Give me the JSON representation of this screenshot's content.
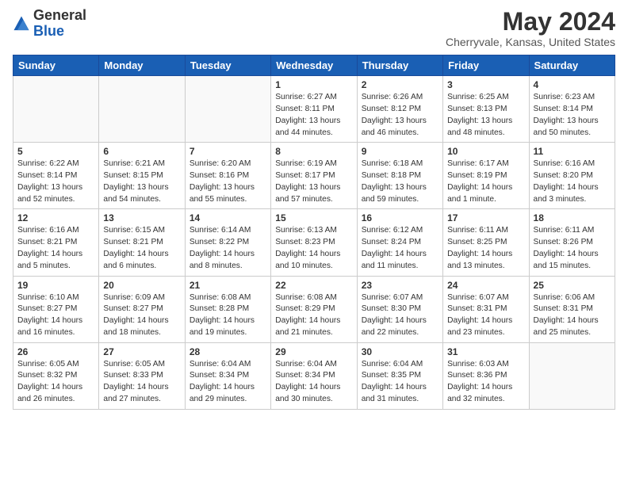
{
  "header": {
    "logo_general": "General",
    "logo_blue": "Blue",
    "month_year": "May 2024",
    "location": "Cherryvale, Kansas, United States"
  },
  "days_of_week": [
    "Sunday",
    "Monday",
    "Tuesday",
    "Wednesday",
    "Thursday",
    "Friday",
    "Saturday"
  ],
  "weeks": [
    [
      {
        "day": "",
        "info": ""
      },
      {
        "day": "",
        "info": ""
      },
      {
        "day": "",
        "info": ""
      },
      {
        "day": "1",
        "info": "Sunrise: 6:27 AM\nSunset: 8:11 PM\nDaylight: 13 hours\nand 44 minutes."
      },
      {
        "day": "2",
        "info": "Sunrise: 6:26 AM\nSunset: 8:12 PM\nDaylight: 13 hours\nand 46 minutes."
      },
      {
        "day": "3",
        "info": "Sunrise: 6:25 AM\nSunset: 8:13 PM\nDaylight: 13 hours\nand 48 minutes."
      },
      {
        "day": "4",
        "info": "Sunrise: 6:23 AM\nSunset: 8:14 PM\nDaylight: 13 hours\nand 50 minutes."
      }
    ],
    [
      {
        "day": "5",
        "info": "Sunrise: 6:22 AM\nSunset: 8:14 PM\nDaylight: 13 hours\nand 52 minutes."
      },
      {
        "day": "6",
        "info": "Sunrise: 6:21 AM\nSunset: 8:15 PM\nDaylight: 13 hours\nand 54 minutes."
      },
      {
        "day": "7",
        "info": "Sunrise: 6:20 AM\nSunset: 8:16 PM\nDaylight: 13 hours\nand 55 minutes."
      },
      {
        "day": "8",
        "info": "Sunrise: 6:19 AM\nSunset: 8:17 PM\nDaylight: 13 hours\nand 57 minutes."
      },
      {
        "day": "9",
        "info": "Sunrise: 6:18 AM\nSunset: 8:18 PM\nDaylight: 13 hours\nand 59 minutes."
      },
      {
        "day": "10",
        "info": "Sunrise: 6:17 AM\nSunset: 8:19 PM\nDaylight: 14 hours\nand 1 minute."
      },
      {
        "day": "11",
        "info": "Sunrise: 6:16 AM\nSunset: 8:20 PM\nDaylight: 14 hours\nand 3 minutes."
      }
    ],
    [
      {
        "day": "12",
        "info": "Sunrise: 6:16 AM\nSunset: 8:21 PM\nDaylight: 14 hours\nand 5 minutes."
      },
      {
        "day": "13",
        "info": "Sunrise: 6:15 AM\nSunset: 8:21 PM\nDaylight: 14 hours\nand 6 minutes."
      },
      {
        "day": "14",
        "info": "Sunrise: 6:14 AM\nSunset: 8:22 PM\nDaylight: 14 hours\nand 8 minutes."
      },
      {
        "day": "15",
        "info": "Sunrise: 6:13 AM\nSunset: 8:23 PM\nDaylight: 14 hours\nand 10 minutes."
      },
      {
        "day": "16",
        "info": "Sunrise: 6:12 AM\nSunset: 8:24 PM\nDaylight: 14 hours\nand 11 minutes."
      },
      {
        "day": "17",
        "info": "Sunrise: 6:11 AM\nSunset: 8:25 PM\nDaylight: 14 hours\nand 13 minutes."
      },
      {
        "day": "18",
        "info": "Sunrise: 6:11 AM\nSunset: 8:26 PM\nDaylight: 14 hours\nand 15 minutes."
      }
    ],
    [
      {
        "day": "19",
        "info": "Sunrise: 6:10 AM\nSunset: 8:27 PM\nDaylight: 14 hours\nand 16 minutes."
      },
      {
        "day": "20",
        "info": "Sunrise: 6:09 AM\nSunset: 8:27 PM\nDaylight: 14 hours\nand 18 minutes."
      },
      {
        "day": "21",
        "info": "Sunrise: 6:08 AM\nSunset: 8:28 PM\nDaylight: 14 hours\nand 19 minutes."
      },
      {
        "day": "22",
        "info": "Sunrise: 6:08 AM\nSunset: 8:29 PM\nDaylight: 14 hours\nand 21 minutes."
      },
      {
        "day": "23",
        "info": "Sunrise: 6:07 AM\nSunset: 8:30 PM\nDaylight: 14 hours\nand 22 minutes."
      },
      {
        "day": "24",
        "info": "Sunrise: 6:07 AM\nSunset: 8:31 PM\nDaylight: 14 hours\nand 23 minutes."
      },
      {
        "day": "25",
        "info": "Sunrise: 6:06 AM\nSunset: 8:31 PM\nDaylight: 14 hours\nand 25 minutes."
      }
    ],
    [
      {
        "day": "26",
        "info": "Sunrise: 6:05 AM\nSunset: 8:32 PM\nDaylight: 14 hours\nand 26 minutes."
      },
      {
        "day": "27",
        "info": "Sunrise: 6:05 AM\nSunset: 8:33 PM\nDaylight: 14 hours\nand 27 minutes."
      },
      {
        "day": "28",
        "info": "Sunrise: 6:04 AM\nSunset: 8:34 PM\nDaylight: 14 hours\nand 29 minutes."
      },
      {
        "day": "29",
        "info": "Sunrise: 6:04 AM\nSunset: 8:34 PM\nDaylight: 14 hours\nand 30 minutes."
      },
      {
        "day": "30",
        "info": "Sunrise: 6:04 AM\nSunset: 8:35 PM\nDaylight: 14 hours\nand 31 minutes."
      },
      {
        "day": "31",
        "info": "Sunrise: 6:03 AM\nSunset: 8:36 PM\nDaylight: 14 hours\nand 32 minutes."
      },
      {
        "day": "",
        "info": ""
      }
    ]
  ]
}
